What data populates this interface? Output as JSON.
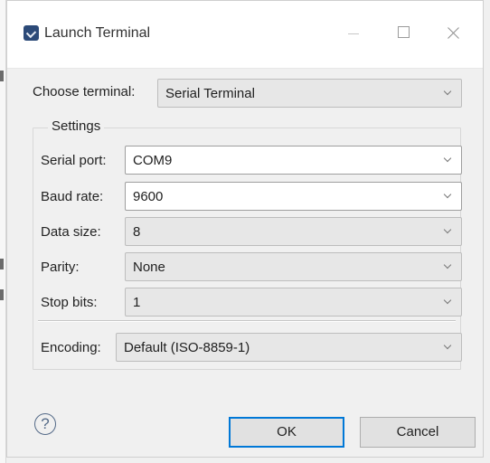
{
  "window": {
    "title": "Launch Terminal",
    "app_icon": "terminal-icon",
    "controls": {
      "minimize_icon": "minimize-icon",
      "maximize_icon": "maximize-icon",
      "close_icon": "close-icon"
    }
  },
  "choose_terminal": {
    "label": "Choose terminal:",
    "value": "Serial Terminal"
  },
  "settings": {
    "title": "Settings",
    "serial_port": {
      "label": "Serial port:",
      "value": "COM9"
    },
    "baud_rate": {
      "label": "Baud rate:",
      "value": "9600"
    },
    "data_size": {
      "label": "Data size:",
      "value": "8"
    },
    "parity": {
      "label": "Parity:",
      "value": "None"
    },
    "stop_bits": {
      "label": "Stop bits:",
      "value": "1"
    },
    "encoding": {
      "label": "Encoding:",
      "value": "Default (ISO-8859-1)"
    }
  },
  "footer": {
    "help_icon": "help-icon",
    "help_text": "?",
    "ok_label": "OK",
    "cancel_label": "Cancel"
  },
  "colors": {
    "dialog_background": "#f0f0f0",
    "title_background": "#ffffff",
    "combo_background": "#e7e7e7",
    "combo_border": "#bdbdbd",
    "focus_border": "#0078d7",
    "help_accent": "#536987"
  }
}
